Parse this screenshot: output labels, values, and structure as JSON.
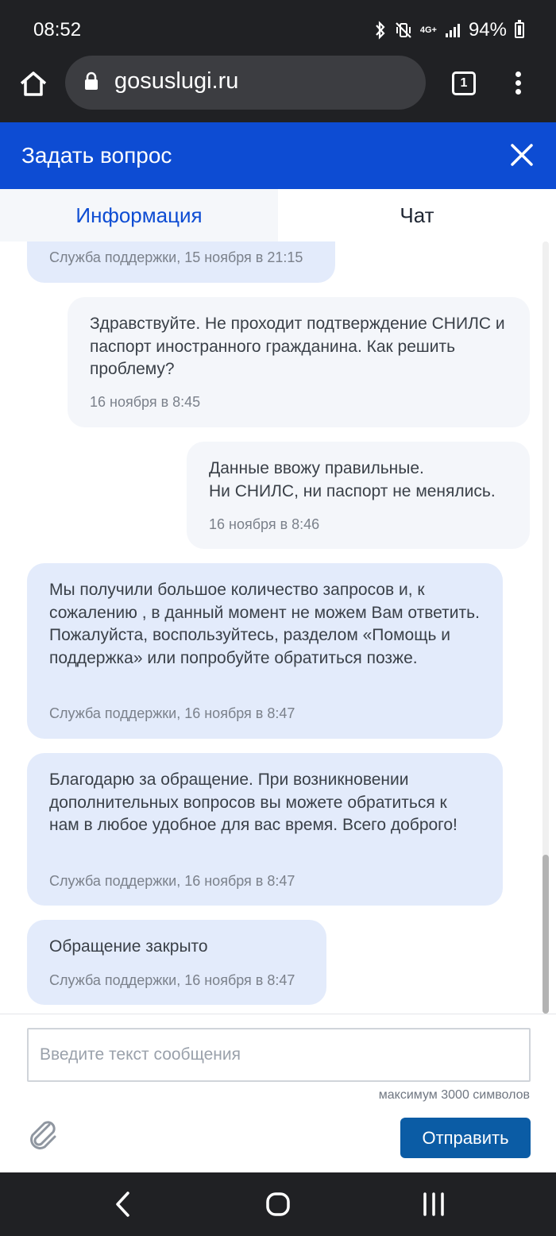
{
  "status_bar": {
    "time": "08:52",
    "network": "4G+",
    "battery": "94%"
  },
  "browser": {
    "url": "gosuslugi.ru",
    "tab_count": "1"
  },
  "dialog": {
    "title": "Задать вопрос",
    "accent_color": "#0d4cd3"
  },
  "tabs": [
    {
      "label": "Информация",
      "active": true
    },
    {
      "label": "Чат",
      "active": false
    }
  ],
  "messages": [
    {
      "from": "support",
      "text": "",
      "meta": "Служба поддержки, 15 ноября в 21:15"
    },
    {
      "from": "user",
      "text": "Здравствуйте. Не проходит подтверждение СНИЛС и паспорт иностранного гражданина. Как решить проблему?",
      "meta": "16 ноября в 8:45"
    },
    {
      "from": "user",
      "text": "Данные ввожу правильные.\nНи СНИЛС, ни паспорт не менялись.",
      "meta": "16 ноября в 8:46"
    },
    {
      "from": "support",
      "text": "Мы получили большое количество запросов и, к сожалению , в данный момент не можем Вам ответить. Пожалуйста, воспользуйтесь, разделом «Помощь и поддержка» или попробуйте обратиться позже.",
      "meta": "Служба поддержки, 16 ноября в 8:47"
    },
    {
      "from": "support",
      "text": "Благодарю за обращение. При возникновении дополнительных вопросов вы можете обратиться к нам в любое удобное для вас время. Всего доброго!",
      "meta": "Служба поддержки, 16 ноября в 8:47"
    },
    {
      "from": "support",
      "text": "Обращение закрыто",
      "meta": "Служба поддержки, 16 ноября в 8:47"
    }
  ],
  "composer": {
    "placeholder": "Введите текст сообщения",
    "value": "",
    "limit_note": "максимум 3000 символов",
    "send_label": "Отправить"
  }
}
